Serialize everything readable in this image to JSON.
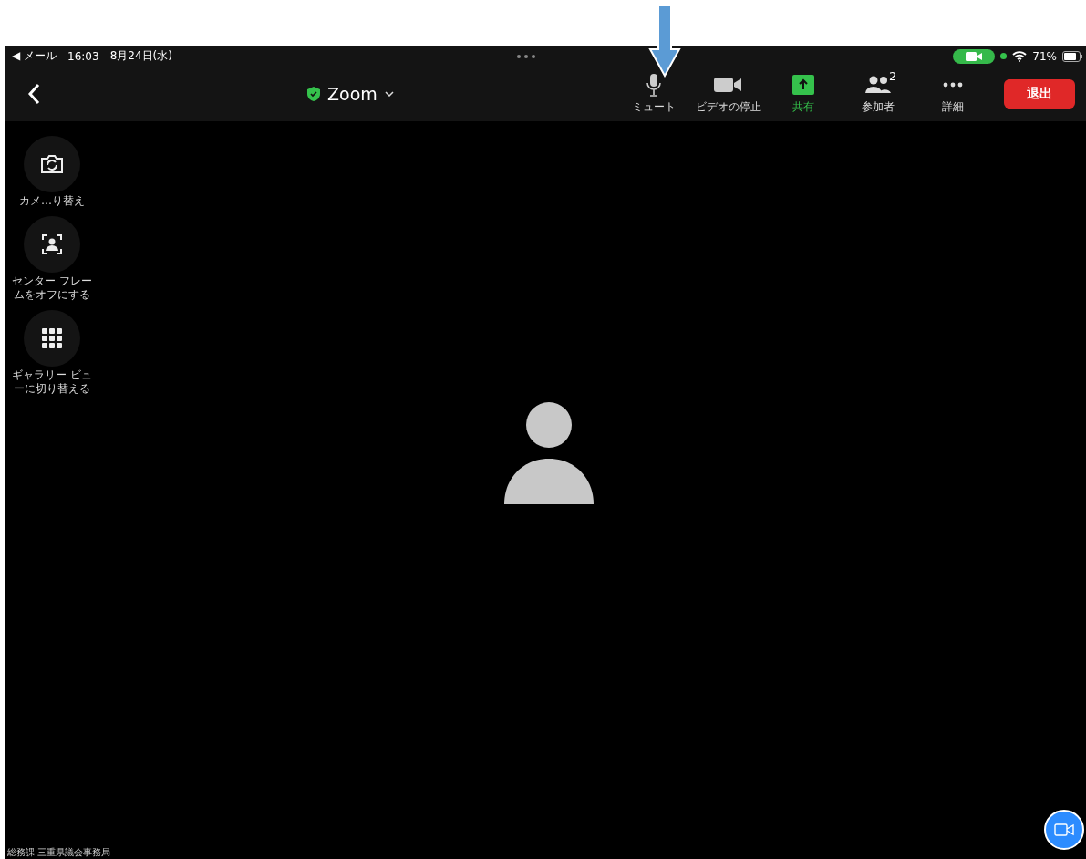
{
  "status_bar": {
    "back_app": "◀ メール",
    "time": "16:03",
    "date": "8月24日(水)",
    "battery": "71%"
  },
  "header": {
    "title": "Zoom"
  },
  "toolbar": [
    {
      "kind": "mic",
      "label": "ミュート"
    },
    {
      "kind": "video",
      "label": "ビデオの停止"
    },
    {
      "kind": "share",
      "label": "共有"
    },
    {
      "kind": "participants",
      "label": "参加者",
      "count": "2"
    },
    {
      "kind": "more",
      "label": "詳細"
    }
  ],
  "leave_button": {
    "label": "退出"
  },
  "side_buttons": [
    {
      "kind": "camera-switch",
      "label": "カメ…り替え"
    },
    {
      "kind": "center-frame",
      "label": "センター フレームをオフにする"
    },
    {
      "kind": "gallery",
      "label": "ギャラリー ビューに切り替える"
    }
  ],
  "footer": {
    "caption": "総務課 三重県議会事務局"
  }
}
